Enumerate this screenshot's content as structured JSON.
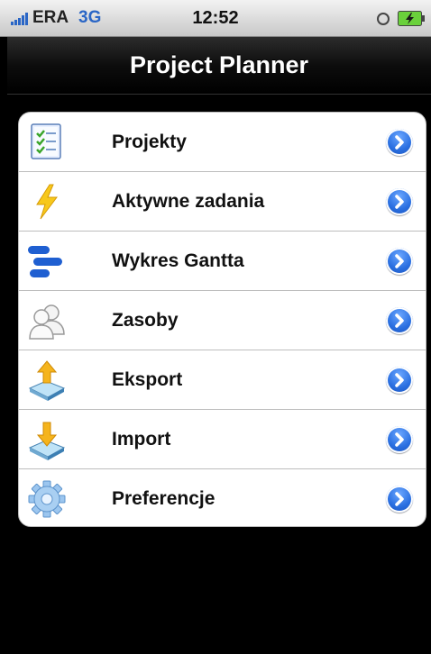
{
  "status_bar": {
    "carrier": "ERA",
    "network": "3G",
    "time": "12:52"
  },
  "navbar": {
    "title": "Project Planner"
  },
  "menu": {
    "items": [
      {
        "label": "Projekty",
        "icon": "checklist-icon"
      },
      {
        "label": "Aktywne zadania",
        "icon": "lightning-icon"
      },
      {
        "label": "Wykres Gantta",
        "icon": "gantt-chart-icon"
      },
      {
        "label": "Zasoby",
        "icon": "people-icon"
      },
      {
        "label": "Eksport",
        "icon": "export-icon"
      },
      {
        "label": "Import",
        "icon": "import-icon"
      },
      {
        "label": "Preferencje",
        "icon": "gear-icon"
      }
    ]
  },
  "colors": {
    "accent": "#2a6fe0",
    "navbar": "#000000",
    "background": "#000000"
  }
}
